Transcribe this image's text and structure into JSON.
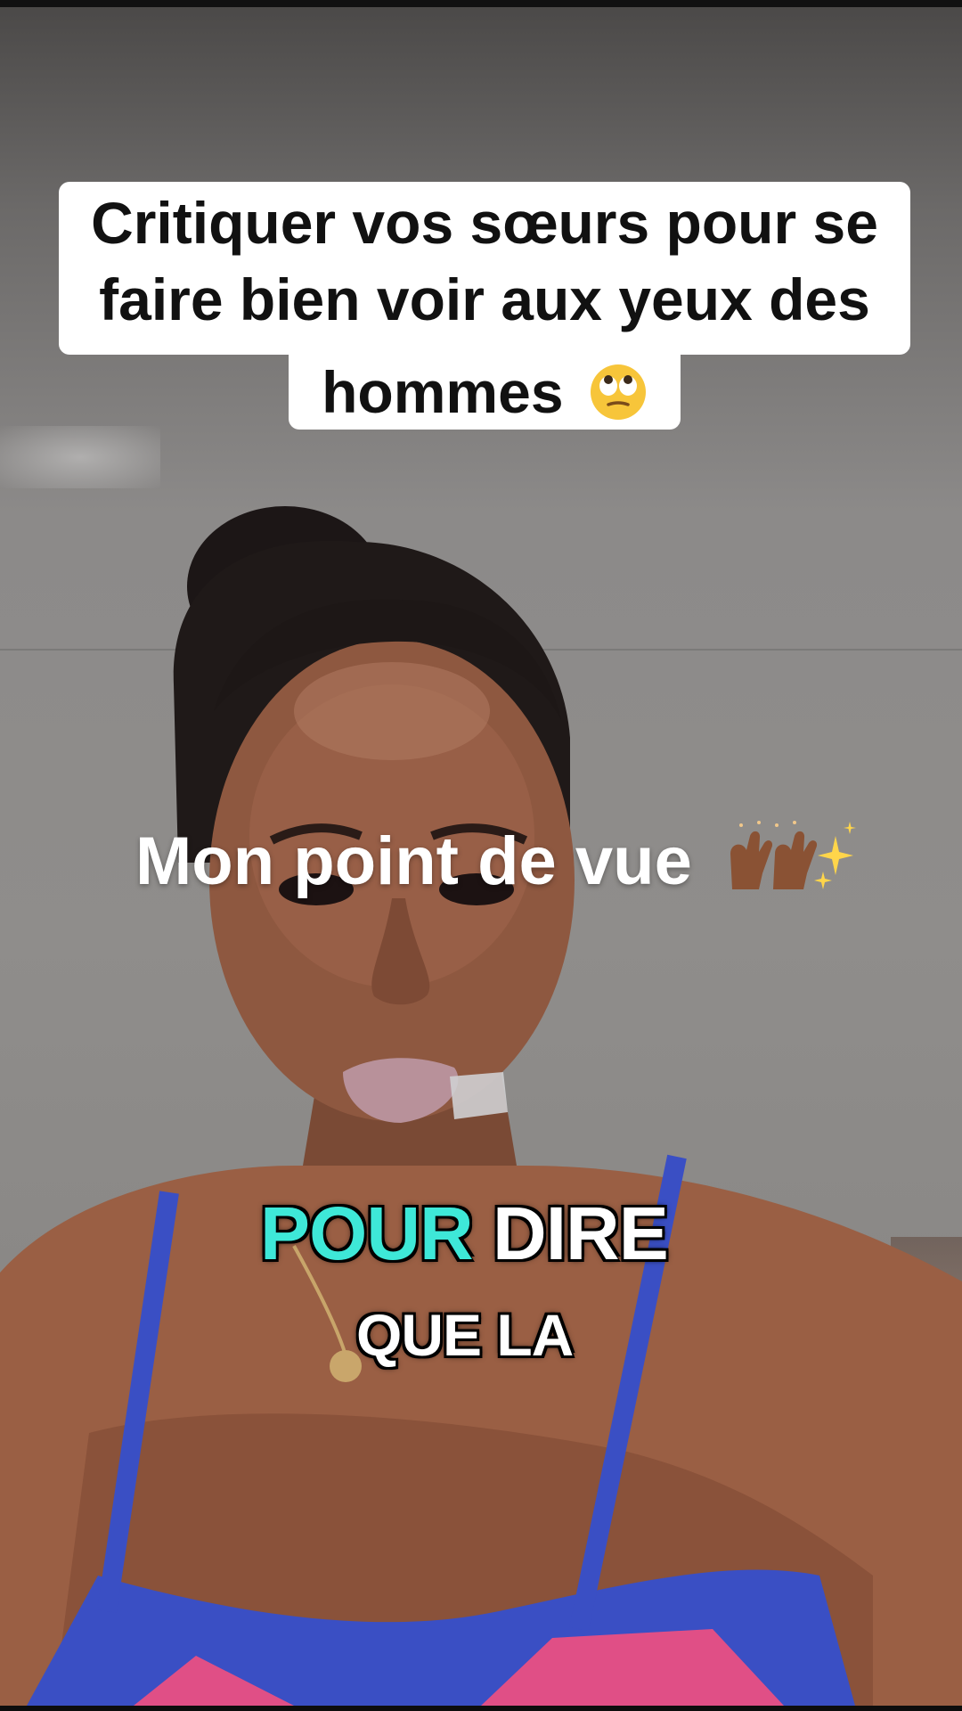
{
  "video": {
    "top_caption": {
      "line1": "Critiquer vos sœurs pour se",
      "line2": "faire bien voir aux yeux des",
      "line3": "hommes",
      "emoji": "face-with-rolling-eyes-icon"
    },
    "overlay_text": "Mon point de vue",
    "overlay_emojis": [
      "raising-hands-icon",
      "sparkles-icon"
    ],
    "subtitle": {
      "word_highlight": "POUR",
      "word_rest": "DIRE",
      "line2": "QUE LA",
      "accent_color": "#3ee8d8"
    }
  }
}
